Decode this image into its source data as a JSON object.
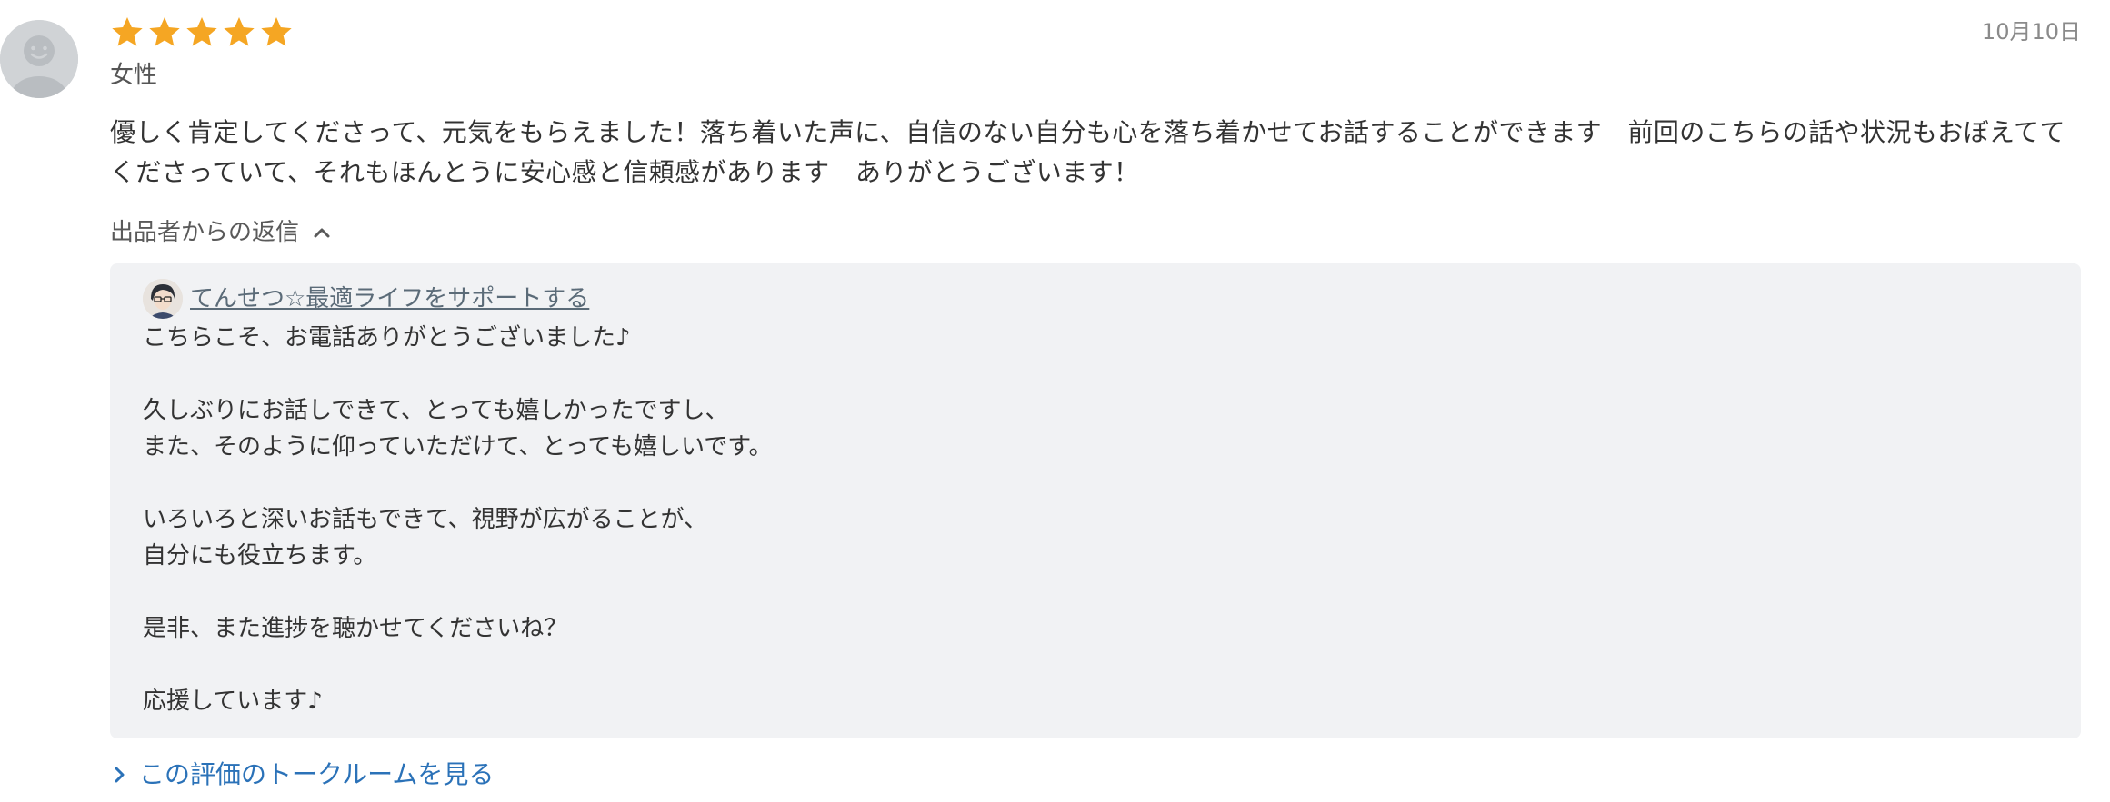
{
  "review": {
    "rating": 5,
    "rating_max": 5,
    "star_color": "#f5a623",
    "gender": "女性",
    "date": "10月10日",
    "text": "優しく肯定してくださって、元気をもらえました！落ち着いた声に、自信のない自分も心を落ち着かせてお話することができます　前回のこちらの話や状況もおぼえててくださっていて、それもほんとうに安心感と信頼感があります　ありがとうございます！"
  },
  "reply_section": {
    "toggle_label": "出品者からの返信",
    "seller_name": "てんせつ☆最適ライフをサポートする",
    "lines": [
      "こちらこそ、お電話ありがとうございました♪",
      "",
      "久しぶりにお話しできて、とっても嬉しかったですし、",
      "また、そのように仰っていただけて、とっても嬉しいです。",
      "",
      "いろいろと深いお話もできて、視野が広がることが、",
      "自分にも役立ちます。",
      "",
      "是非、また進捗を聴かせてくださいね？",
      "",
      "応援しています♪"
    ]
  },
  "talkroom_link": {
    "label": "この評価のトークルームを見る",
    "color": "#2b72b8"
  }
}
